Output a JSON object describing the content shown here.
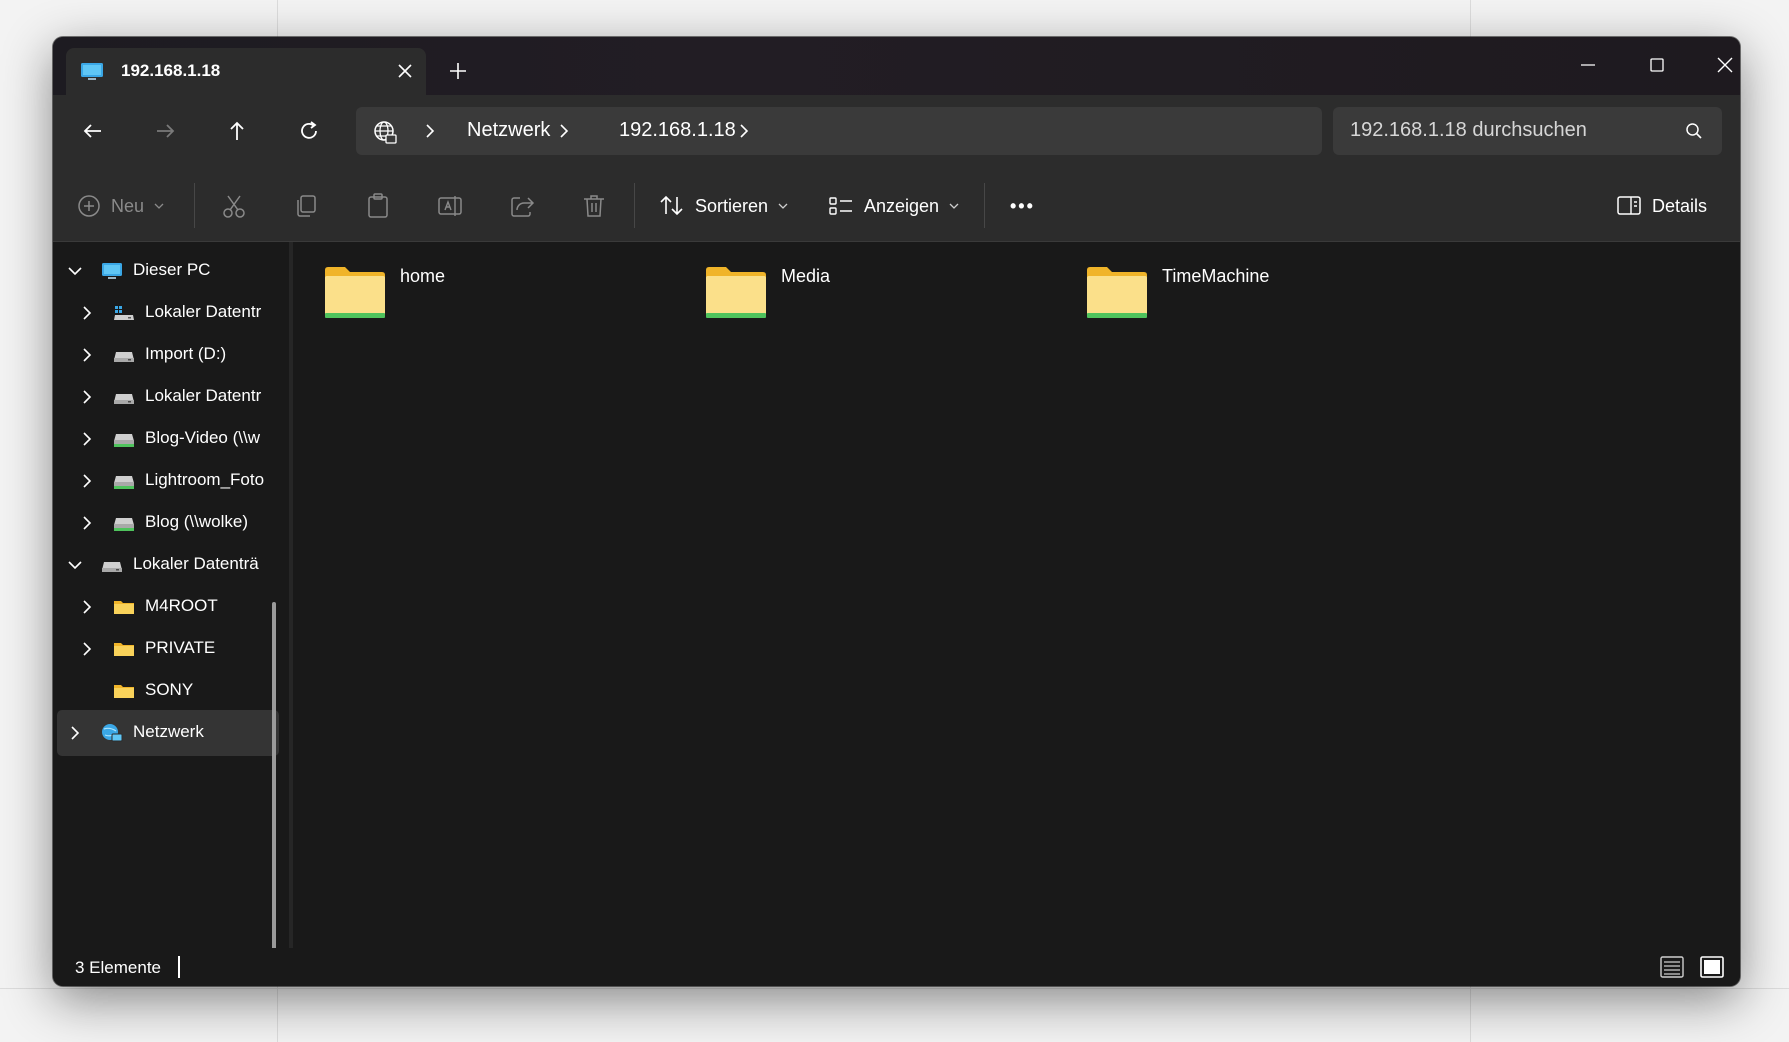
{
  "tab": {
    "title": "192.168.1.18"
  },
  "address": {
    "crumbs": [
      "Netzwerk",
      "192.168.1.18"
    ]
  },
  "search": {
    "placeholder": "192.168.1.18 durchsuchen"
  },
  "commands": {
    "new": "Neu",
    "sort": "Sortieren",
    "view": "Anzeigen",
    "more": "•••",
    "details": "Details"
  },
  "sidebar": {
    "items": [
      {
        "label": "Dieser PC",
        "icon": "monitor-icon"
      },
      {
        "label": "Lokaler Datentr",
        "icon": "system-drive-icon"
      },
      {
        "label": "Import (D:)",
        "icon": "drive-icon"
      },
      {
        "label": "Lokaler Datentr",
        "icon": "drive-icon"
      },
      {
        "label": "Blog-Video (\\\\w",
        "icon": "network-drive-icon"
      },
      {
        "label": "Lightroom_Foto",
        "icon": "network-drive-icon"
      },
      {
        "label": "Blog (\\\\wolke)",
        "icon": "network-drive-icon"
      },
      {
        "label": "Lokaler Datenträ",
        "icon": "drive-icon"
      },
      {
        "label": "M4ROOT",
        "icon": "folder-icon"
      },
      {
        "label": "PRIVATE",
        "icon": "folder-icon"
      },
      {
        "label": "SONY",
        "icon": "folder-icon"
      },
      {
        "label": "Netzwerk",
        "icon": "network-icon"
      }
    ]
  },
  "folders": [
    {
      "name": "home"
    },
    {
      "name": "Media"
    },
    {
      "name": "TimeMachine"
    }
  ],
  "status": {
    "count": "3 Elemente"
  },
  "colors": {
    "folder": "#f9c93c",
    "folder_front": "#fbe08a",
    "network_stripe": "#4fc35d",
    "accent": "#4cc2ff"
  }
}
